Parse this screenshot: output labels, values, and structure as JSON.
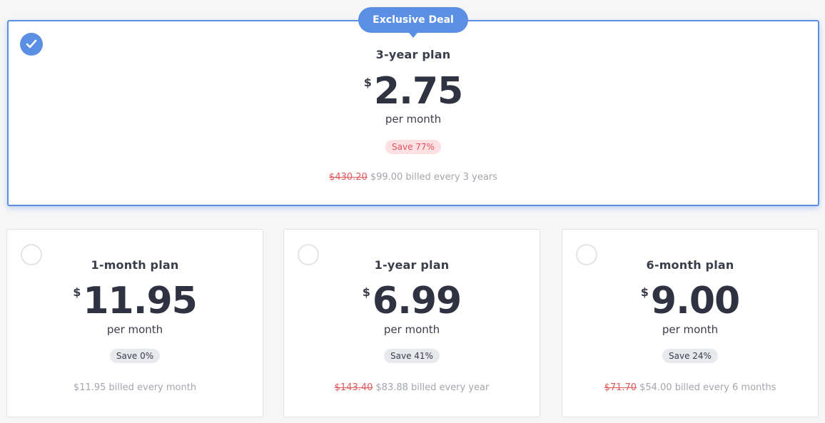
{
  "featured": {
    "badge": "Exclusive Deal",
    "plan_name": "3-year plan",
    "currency": "$",
    "price": "2.75",
    "per": "per month",
    "save": "Save 77%",
    "old_price": "$430.20",
    "billing": "$99.00 billed every 3 years",
    "selected": true
  },
  "plans": [
    {
      "plan_name": "1-month plan",
      "currency": "$",
      "price": "11.95",
      "per": "per month",
      "save": "Save 0%",
      "old_price": "",
      "billing": "$11.95 billed every month"
    },
    {
      "plan_name": "1-year plan",
      "currency": "$",
      "price": "6.99",
      "per": "per month",
      "save": "Save 41%",
      "old_price": "$143.40",
      "billing": "$83.88 billed every year"
    },
    {
      "plan_name": "6-month plan",
      "currency": "$",
      "price": "9.00",
      "per": "per month",
      "save": "Save 24%",
      "old_price": "$71.70",
      "billing": "$54.00 billed every 6 months"
    }
  ],
  "colors": {
    "accent": "#5b8fe3",
    "strike": "#e05a5f",
    "save_hot_bg": "#fde0e2"
  },
  "icons": {
    "selected": "checkmark-icon",
    "unselected": "radio-circle-icon"
  }
}
